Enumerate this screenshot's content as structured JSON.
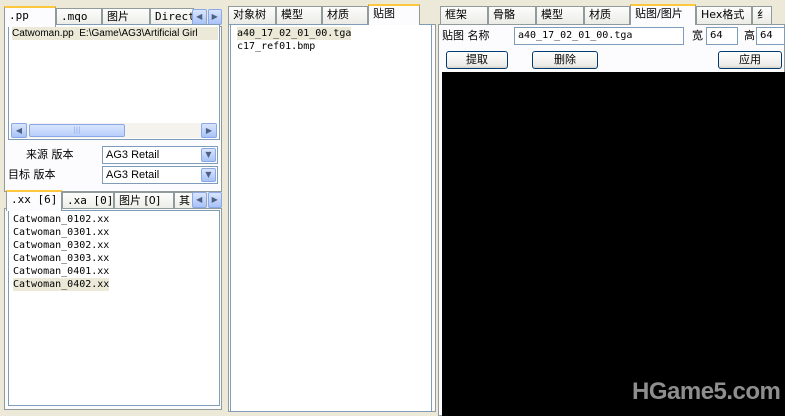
{
  "left_top": {
    "tabs": [
      ".pp",
      ".mqo",
      "图片",
      "Direct"
    ],
    "active_tab": ".pp",
    "file_name": "Catwoman.pp",
    "file_path": "E:\\Game\\AG3\\Artificial Girl",
    "source_label": "来源 版本",
    "source_value": "AG3 Retail",
    "target_label": "目标 版本",
    "target_value": "AG3 Retail"
  },
  "left_bottom": {
    "tabs": [
      ".xx [6]",
      ".xa [0]",
      "图片 [0]",
      "其"
    ],
    "active_tab": ".xx [6]",
    "items": [
      "Catwoman_0102.xx",
      "Catwoman_0301.xx",
      "Catwoman_0302.xx",
      "Catwoman_0303.xx",
      "Catwoman_0401.xx",
      "Catwoman_0402.xx"
    ]
  },
  "middle": {
    "tabs": [
      "对象树",
      "模型",
      "材质",
      "贴图"
    ],
    "active_tab": "贴图",
    "items": [
      "a40_17_02_01_00.tga",
      "c17_ref01.bmp"
    ]
  },
  "right": {
    "tabs": [
      "框架",
      "骨骼",
      "模型",
      "材质",
      "贴图/图片",
      "Hex格式",
      "纟"
    ],
    "active_tab": "贴图/图片",
    "texture_label": "贴图 名称",
    "texture_name": "a40_17_02_01_00.tga",
    "width_label": "宽",
    "width_value": "64",
    "height_label": "高",
    "height_value": "64",
    "extract_button": "提取",
    "delete_button": "删除",
    "apply_button": "应用"
  },
  "watermark": "HGame5.com"
}
